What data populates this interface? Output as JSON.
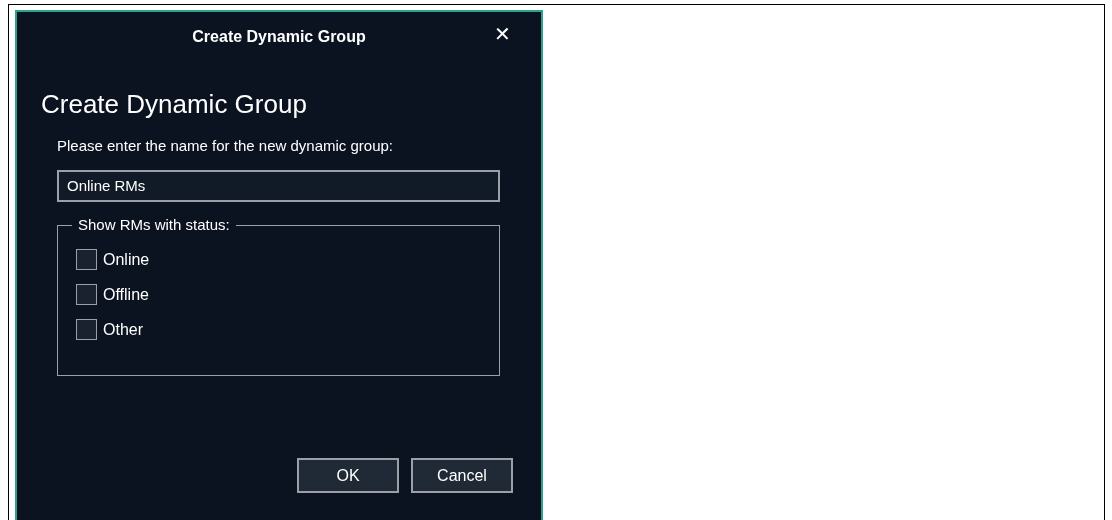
{
  "window": {
    "title": "Create Dynamic Group",
    "close": "✕"
  },
  "heading": "Create Dynamic Group",
  "name_field": {
    "label": "Please enter the name for the new dynamic group:",
    "value": "Online RMs"
  },
  "status_group": {
    "legend": "Show RMs with status:",
    "options": [
      {
        "label": "Online",
        "checked": false
      },
      {
        "label": "Offline",
        "checked": false
      },
      {
        "label": "Other",
        "checked": false
      }
    ]
  },
  "buttons": [
    "OK",
    "Cancel"
  ]
}
